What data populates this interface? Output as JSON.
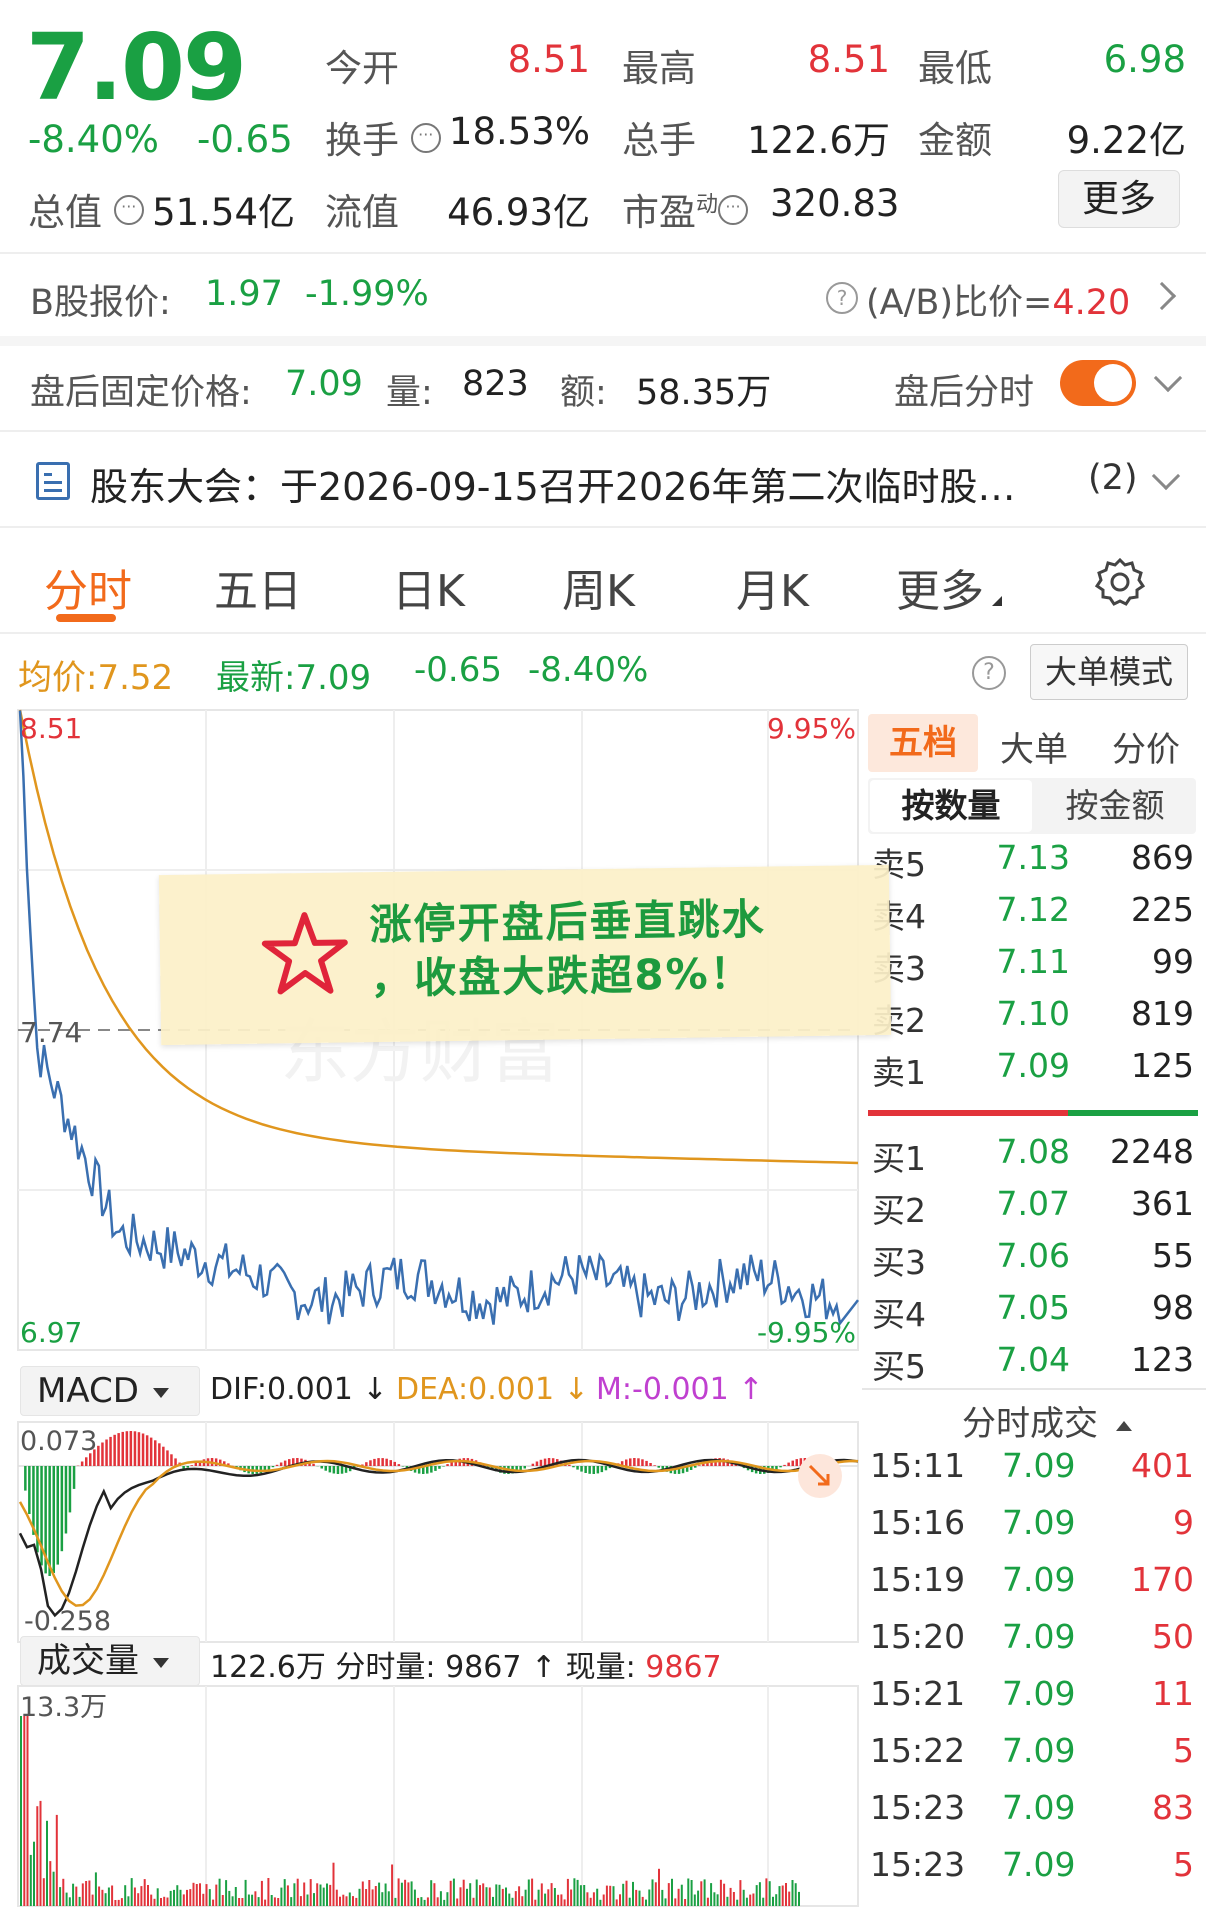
{
  "quote": {
    "price": "7.09",
    "change_pct": "-8.40%",
    "change": "-0.65",
    "open_label": "今开",
    "open": "8.51",
    "high_label": "最高",
    "high": "8.51",
    "low_label": "最低",
    "low": "6.98",
    "turnover_label": "换手",
    "turnover": "18.53%",
    "volume_label": "总手",
    "volume": "122.6万",
    "amount_label": "金额",
    "amount": "9.22亿",
    "mktcap_label": "总值",
    "mktcap": "51.54亿",
    "float_label": "流值",
    "float": "46.93亿",
    "pe_label": "市盈",
    "pe_sup": "动",
    "pe": "320.83",
    "more": "更多"
  },
  "bshare": {
    "label": "B股报价:",
    "price": "1.97",
    "pct": "-1.99%",
    "ratio_label": "(A/B)比价=",
    "ratio": "4.20"
  },
  "after_hours": {
    "label": "盘后固定价格:",
    "price": "7.09",
    "vol_label": "量:",
    "vol": "823",
    "amt_label": "额:",
    "amt": "58.35万",
    "toggle_label": "盘后分时"
  },
  "notice": {
    "text": "股东大会：于2026-09-15召开2026年第二次临时股…",
    "count": "(2)"
  },
  "tabs": [
    "分时",
    "五日",
    "日K",
    "周K",
    "月K",
    "更多"
  ],
  "intraday": {
    "avg_label": "均价:",
    "avg": "7.52",
    "latest_label": "最新:",
    "latest": "7.09",
    "chg": "-0.65",
    "pct": "-8.40%",
    "big_order_mode": "大单模式",
    "top_price": "8.51",
    "mid_price": "7.74",
    "bottom_price": "6.97",
    "top_pct": "9.95%",
    "bottom_pct": "-9.95%",
    "watermark": "东方财富"
  },
  "macd": {
    "label": "MACD",
    "dif": "DIF:0.001 ↓",
    "dea": "DEA:0.001 ↓",
    "m": "M:-0.001 ↑",
    "top": "0.073",
    "bottom": "-0.258"
  },
  "volume": {
    "label": "成交量",
    "summary": "122.6万 分时量: 9867 ↑ 现量:",
    "current": "9867",
    "max": "13.3万"
  },
  "orderbook": {
    "tabs": [
      "五档",
      "大单",
      "分价"
    ],
    "subtabs": [
      "按数量",
      "按金额"
    ],
    "asks": [
      {
        "label": "卖5",
        "price": "7.13",
        "vol": "869"
      },
      {
        "label": "卖4",
        "price": "7.12",
        "vol": "225"
      },
      {
        "label": "卖3",
        "price": "7.11",
        "vol": "99"
      },
      {
        "label": "卖2",
        "price": "7.10",
        "vol": "819"
      },
      {
        "label": "卖1",
        "price": "7.09",
        "vol": "125"
      }
    ],
    "bids": [
      {
        "label": "买1",
        "price": "7.08",
        "vol": "2248"
      },
      {
        "label": "买2",
        "price": "7.07",
        "vol": "361"
      },
      {
        "label": "买3",
        "price": "7.06",
        "vol": "55"
      },
      {
        "label": "买4",
        "price": "7.05",
        "vol": "98"
      },
      {
        "label": "买5",
        "price": "7.04",
        "vol": "123"
      }
    ]
  },
  "ticks": {
    "title": "分时成交",
    "rows": [
      {
        "t": "15:11",
        "p": "7.09",
        "v": "401"
      },
      {
        "t": "15:16",
        "p": "7.09",
        "v": "9"
      },
      {
        "t": "15:19",
        "p": "7.09",
        "v": "170"
      },
      {
        "t": "15:20",
        "p": "7.09",
        "v": "50"
      },
      {
        "t": "15:21",
        "p": "7.09",
        "v": "11"
      },
      {
        "t": "15:22",
        "p": "7.09",
        "v": "5"
      },
      {
        "t": "15:23",
        "p": "7.09",
        "v": "83"
      },
      {
        "t": "15:23",
        "p": "7.09",
        "v": "5"
      }
    ]
  },
  "annotation": {
    "line1": "涨停开盘后垂直跳水",
    "line2": "，收盘大跌超8%！"
  },
  "colors": {
    "up": "#e2333a",
    "down": "#1aa043",
    "accent": "#f26a1b",
    "avg_line": "#e0961e",
    "price_line": "#3a6fb0"
  }
}
